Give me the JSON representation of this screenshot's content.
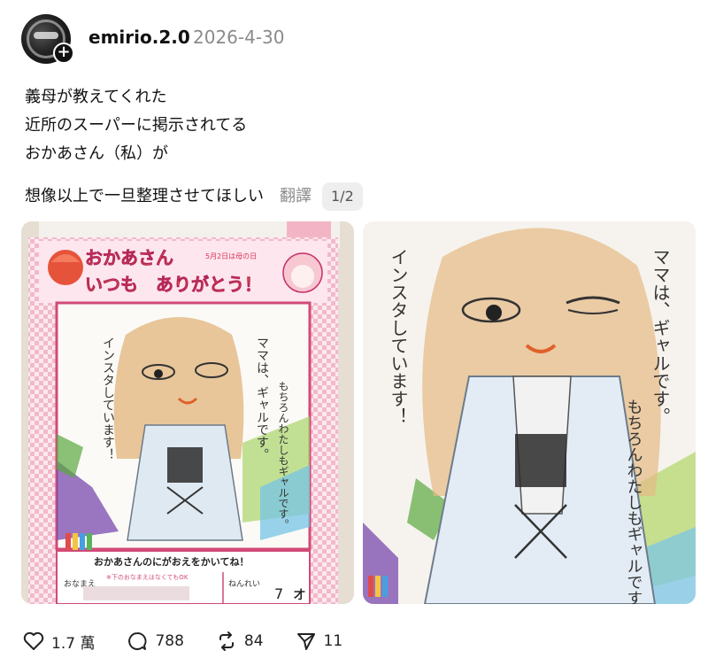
{
  "post": {
    "username": "emirio.2.0",
    "date": "2026-4-30",
    "lines": [
      "義母が教えてくれた",
      "近所のスーパーに掲示されてる",
      "おかあさん（私）が"
    ],
    "last_line": "想像以上で一旦整理させてほしい",
    "translate_label": "翻譯",
    "page_indicator": "1/2"
  },
  "drawing": {
    "header_line1": "おかあさん",
    "header_line2": "いつも　ありがとう！",
    "header_small": "5月2日は母の日",
    "vertical_left": "インスタしています！",
    "vertical_right1": "ママは、ギャルです。",
    "vertical_right2": "もちろんわたしもギャルです。",
    "caption": "おかあさんのにがおえをかいてね！",
    "name_label": "おなまえ",
    "name_note": "※下のおなまえはなくてもOK",
    "age_label": "ねんれい",
    "age_value": "7",
    "age_unit": "才"
  },
  "actions": {
    "likes": "1.7 萬",
    "comments": "788",
    "reposts": "84",
    "shares": "11"
  }
}
